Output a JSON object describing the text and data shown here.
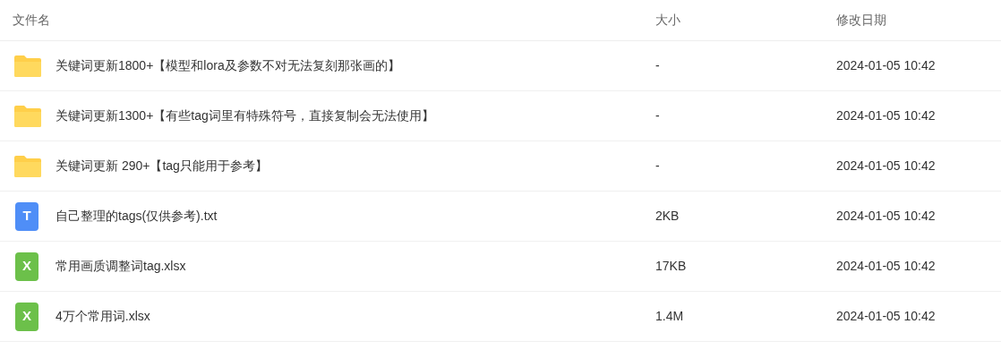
{
  "columns": [
    "文件名",
    "大小",
    "修改日期"
  ],
  "rows": [
    {
      "kind": "folder",
      "name": "关键词更新1800+【模型和lora及参数不对无法复刻那张画的】",
      "size": "-",
      "modified": "2024-01-05 10:42"
    },
    {
      "kind": "folder",
      "name": "关键词更新1300+【有些tag词里有特殊符号，直接复制会无法使用】",
      "size": "-",
      "modified": "2024-01-05 10:42"
    },
    {
      "kind": "folder",
      "name": "关键词更新 290+【tag只能用于参考】",
      "size": "-",
      "modified": "2024-01-05 10:42"
    },
    {
      "kind": "text",
      "icon_label": "T",
      "name": "自己整理的tags(仅供参考).txt",
      "size": "2KB",
      "modified": "2024-01-05 10:42"
    },
    {
      "kind": "sheet",
      "icon_label": "X",
      "name": "常用画质调整词tag.xlsx",
      "size": "17KB",
      "modified": "2024-01-05 10:42"
    },
    {
      "kind": "sheet",
      "icon_label": "X",
      "name": "4万个常用词.xlsx",
      "size": "1.4M",
      "modified": "2024-01-05 10:42"
    }
  ]
}
